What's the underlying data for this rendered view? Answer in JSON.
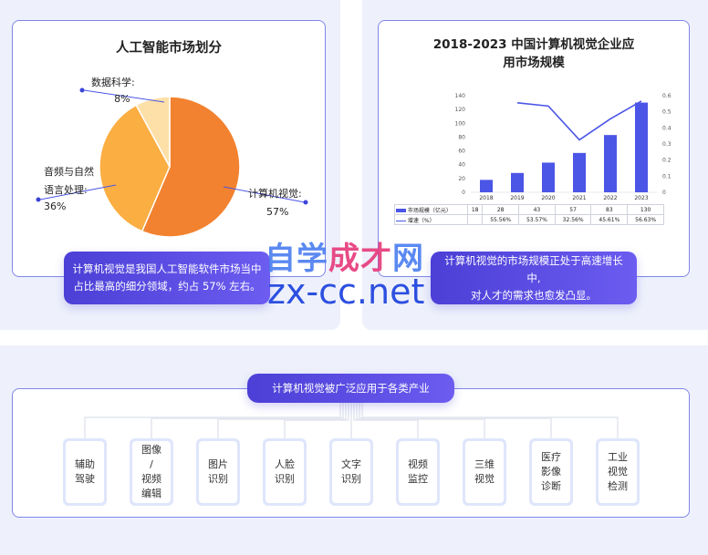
{
  "left_card": {
    "title": "人工智能市场划分",
    "labels": {
      "data_science": "数据科学:",
      "data_science_pct": "8%",
      "audio_nlp_line1": "音频与自然",
      "audio_nlp_line2": "语言处理:",
      "audio_nlp_pct": "36%",
      "cv": "计算机视觉:",
      "cv_pct": "57%"
    },
    "banner": "计算机视觉是我国人工智能软件市场当中占比最高的细分领域，约占 57% 左右。"
  },
  "right_card": {
    "title_line1": "2018-2023 中国计算机视觉企业应",
    "title_line2": "用市场规模",
    "banner_line1": "计算机视觉的市场规模正处于高速增长中,",
    "banner_line2": "对人才的需求也愈发凸显。",
    "table": {
      "row1_label": "市场规模（亿元）",
      "row2_label": "增速（%）",
      "row1_values": [
        "18",
        "28",
        "43",
        "57",
        "83",
        "130"
      ],
      "row2_values": [
        "",
        "55.56%",
        "53.57%",
        "32.56%",
        "45.61%",
        "56.63%"
      ]
    }
  },
  "watermark": {
    "line1_a": "自学",
    "line1_b": "成才",
    "line1_c": "网",
    "line2": "zx-cc.net"
  },
  "industry": {
    "pill_label": "计算机视觉被广泛应用于各类产业",
    "items": [
      "辅助\n驾驶",
      "图像\n/\n视频\n编辑",
      "图片\n识别",
      "人脸\n识别",
      "文字\n识别",
      "视频\n监控",
      "三维\n视觉",
      "医疗\n影像\n诊断",
      "工业\n视觉\n检测"
    ]
  },
  "chart_data": [
    {
      "type": "pie",
      "title": "人工智能市场划分",
      "categories": [
        "计算机视觉",
        "音频与自然语言处理",
        "数据科学"
      ],
      "values": [
        57,
        36,
        8
      ],
      "colors": [
        "#f28230",
        "#fbae42",
        "#fde0a8"
      ]
    },
    {
      "type": "bar",
      "title": "2018-2023 中国计算机视觉企业应用市场规模",
      "categories": [
        "2018",
        "2019",
        "2020",
        "2021",
        "2022",
        "2023"
      ],
      "series": [
        {
          "name": "市场规模（亿元）",
          "type": "bar",
          "axis": "left",
          "values": [
            18,
            28,
            43,
            57,
            83,
            130
          ],
          "color": "#4b55e6"
        },
        {
          "name": "增速（%）",
          "type": "line",
          "axis": "right",
          "values": [
            null,
            0.5556,
            0.5357,
            0.3256,
            0.4561,
            0.5663
          ],
          "color": "#4b55e6"
        }
      ],
      "y_left": {
        "ylim": [
          0,
          140
        ],
        "ticks": [
          0,
          20,
          40,
          60,
          80,
          100,
          120,
          140
        ]
      },
      "y_right": {
        "ylim": [
          0,
          0.6
        ],
        "ticks": [
          0,
          0.1,
          0.2,
          0.3,
          0.4,
          0.5,
          0.6
        ]
      },
      "grid": false,
      "legend": "table-bottom"
    }
  ]
}
